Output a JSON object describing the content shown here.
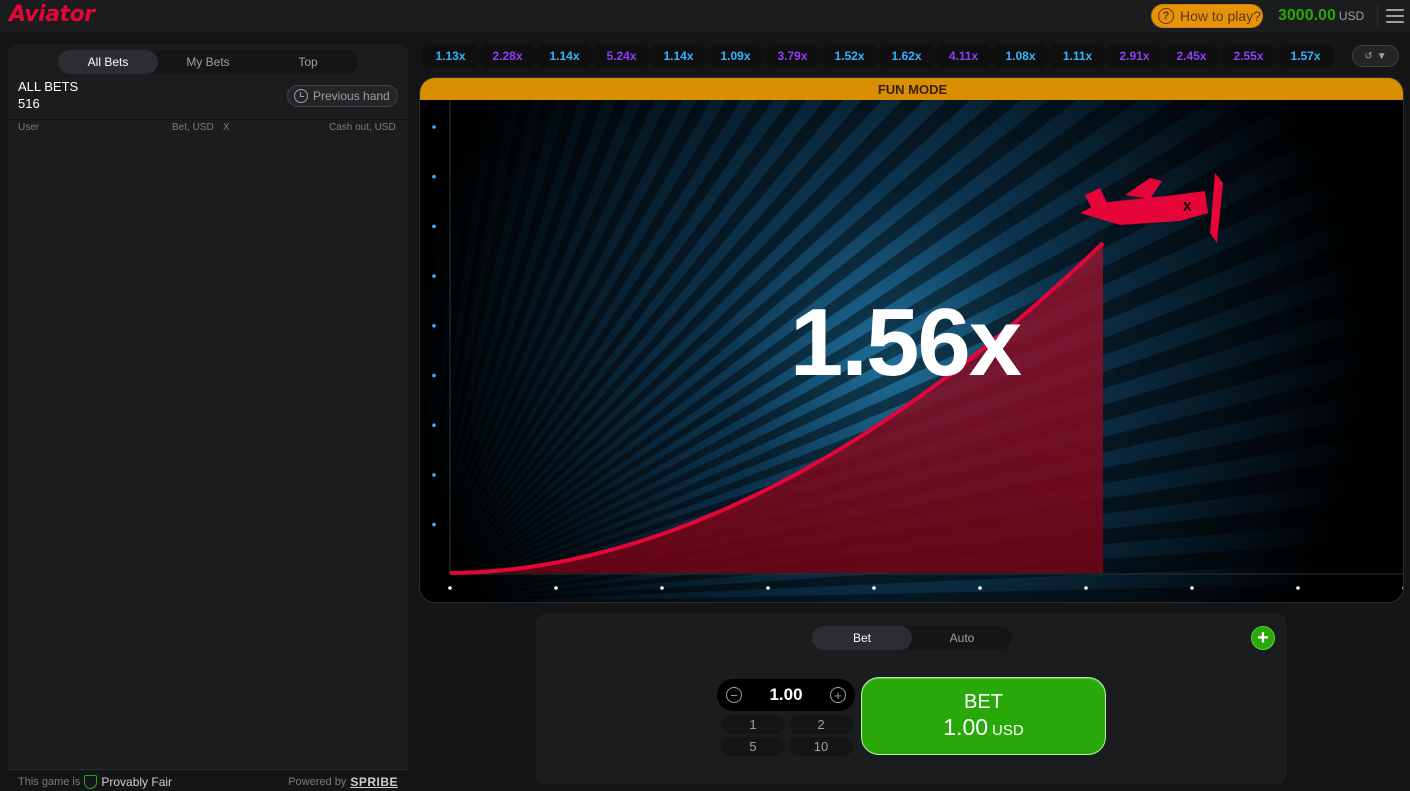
{
  "header": {
    "logo": "Aviator",
    "how_to_play": "How to play?",
    "balance": "3000.00",
    "currency": "USD"
  },
  "bets_panel": {
    "tabs": [
      "All Bets",
      "My Bets",
      "Top"
    ],
    "title": "ALL BETS",
    "count": "516",
    "previous_hand": "Previous hand",
    "columns": {
      "user": "User",
      "bet": "Bet, USD",
      "x": "X",
      "cashout": "Cash out, USD"
    },
    "footer": {
      "this_game_is": "This game is",
      "provably_fair": "Provably Fair",
      "powered_by": "Powered by",
      "brand": "SPRIBE"
    }
  },
  "history": [
    {
      "value": "1.13x",
      "color": "#34b4ff"
    },
    {
      "value": "2.28x",
      "color": "#913ef8"
    },
    {
      "value": "1.14x",
      "color": "#34b4ff"
    },
    {
      "value": "5.24x",
      "color": "#913ef8"
    },
    {
      "value": "1.14x",
      "color": "#34b4ff"
    },
    {
      "value": "1.09x",
      "color": "#34b4ff"
    },
    {
      "value": "3.79x",
      "color": "#913ef8"
    },
    {
      "value": "1.52x",
      "color": "#34b4ff"
    },
    {
      "value": "1.62x",
      "color": "#34b4ff"
    },
    {
      "value": "4.11x",
      "color": "#913ef8"
    },
    {
      "value": "1.08x",
      "color": "#34b4ff"
    },
    {
      "value": "1.11x",
      "color": "#34b4ff"
    },
    {
      "value": "2.91x",
      "color": "#913ef8"
    },
    {
      "value": "2.45x",
      "color": "#913ef8"
    },
    {
      "value": "2.55x",
      "color": "#913ef8"
    },
    {
      "value": "1.57x",
      "color": "#34b4ff"
    }
  ],
  "game": {
    "mode_banner": "FUN MODE",
    "multiplier": "1.56x",
    "curve_color": "#e50539",
    "plane_color": "#e50539"
  },
  "bet_panel": {
    "tabs": [
      "Bet",
      "Auto"
    ],
    "add_label": "+",
    "stake": "1.00",
    "quick_amounts": [
      "1",
      "2",
      "5",
      "10"
    ],
    "bet_label": "BET",
    "bet_amount": "1.00",
    "bet_currency": "USD",
    "accent": "#28a909"
  }
}
